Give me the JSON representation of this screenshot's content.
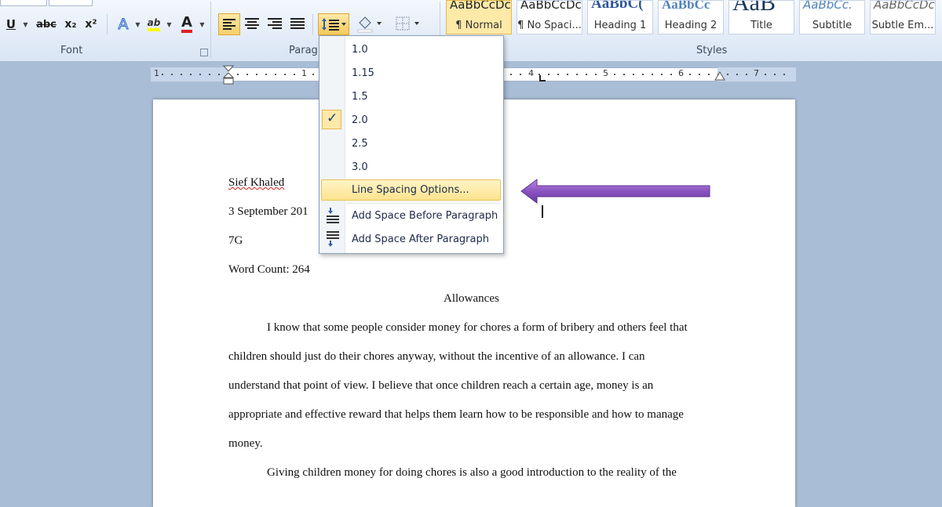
{
  "ribbon": {
    "groups": {
      "font": "Font",
      "paragraph": "Parag",
      "styles": "Styles"
    },
    "font_buttons": {
      "underline": "U",
      "strikethrough": "abc",
      "subscript": "x₂",
      "superscript": "x²",
      "text_effects": "A",
      "highlight": "ab",
      "font_color": "A"
    },
    "styles_gallery": [
      {
        "sample": "AaBbCcDc",
        "name": "¶ Normal",
        "active": true
      },
      {
        "sample": "AaBbCcDc",
        "name": "¶ No Spaci...",
        "active": false
      },
      {
        "sample": "AaBbC(",
        "name": "Heading 1",
        "active": false
      },
      {
        "sample": "AaBbCc",
        "name": "Heading 2",
        "active": false
      },
      {
        "sample": "AaB",
        "name": "Title",
        "active": false
      },
      {
        "sample": "AaBbCc.",
        "name": "Subtitle",
        "active": false
      },
      {
        "sample": "AaBbCcDc",
        "name": "Subtle Em...",
        "active": false
      }
    ]
  },
  "ruler": {
    "numbers": [
      "1",
      "1",
      "4",
      "5",
      "6",
      "7"
    ]
  },
  "line_spacing_menu": {
    "options": [
      "1.0",
      "1.15",
      "1.5",
      "2.0",
      "2.5",
      "3.0"
    ],
    "selected": "2.0",
    "check_mark": "✓",
    "line_spacing_options": "Line Spacing Options...",
    "add_space_before": "Add Space Before Paragraph",
    "add_space_after": "Add Space After Paragraph"
  },
  "document": {
    "header_lines": [
      "Sief Khaled",
      "3 September 201",
      "7G",
      "Word Count: 264"
    ],
    "title": "Allowances",
    "body_lines": [
      "I know that some people consider money for chores a form of bribery and others feel that",
      "children should just do their chores anyway, without the incentive of an allowance. I can",
      "understand that point of view. I believe that once children reach a certain age, money is an",
      "appropriate and effective reward that helps them learn how to be responsible and how to manage",
      "money.",
      "Giving children money for doing chores is also a good introduction to the reality of the"
    ]
  },
  "colors": {
    "arrow": "#8a52c0",
    "highlight": "#fde38e",
    "font_color_bar": "#e02020",
    "highlight_bar": "#ffff00"
  }
}
